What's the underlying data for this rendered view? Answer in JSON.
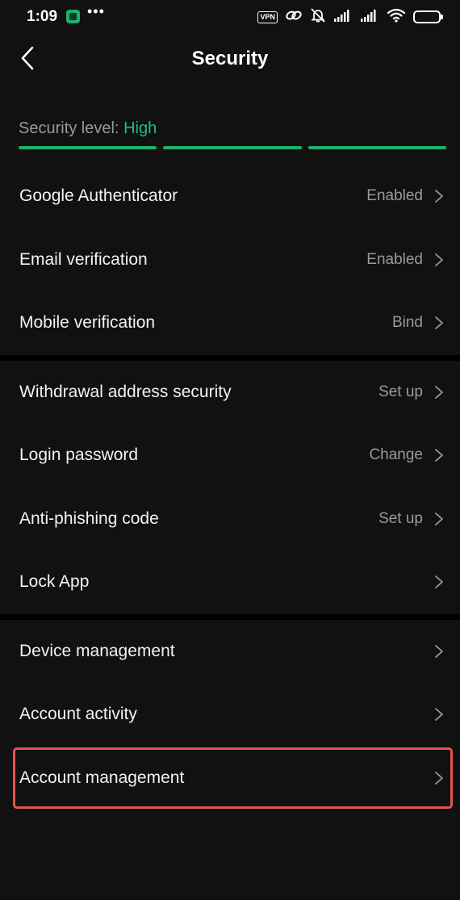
{
  "status_bar": {
    "time": "1:09",
    "dots": "•••",
    "vpn": "VPN",
    "icons": [
      "app-notification-icon",
      "link-icon",
      "bell-off-icon",
      "signal-icon",
      "signal-icon",
      "wifi-icon",
      "battery-icon"
    ]
  },
  "header": {
    "title": "Security",
    "back_icon": "chevron-left-icon"
  },
  "security_level": {
    "label": "Security level:",
    "value": "High",
    "bars_filled": 3,
    "bars_total": 3,
    "accent_color": "#1fbf7a"
  },
  "groups": [
    {
      "items": [
        {
          "label": "Google Authenticator",
          "value": "Enabled"
        },
        {
          "label": "Email verification",
          "value": "Enabled"
        },
        {
          "label": "Mobile verification",
          "value": "Bind"
        }
      ]
    },
    {
      "items": [
        {
          "label": "Withdrawal address security",
          "value": "Set up"
        },
        {
          "label": "Login password",
          "value": "Change"
        },
        {
          "label": "Anti-phishing code",
          "value": "Set up"
        },
        {
          "label": "Lock App",
          "value": ""
        }
      ]
    },
    {
      "items": [
        {
          "label": "Device management",
          "value": ""
        },
        {
          "label": "Account activity",
          "value": ""
        },
        {
          "label": "Account management",
          "value": ""
        }
      ]
    }
  ],
  "highlight_color": "#e3544d"
}
